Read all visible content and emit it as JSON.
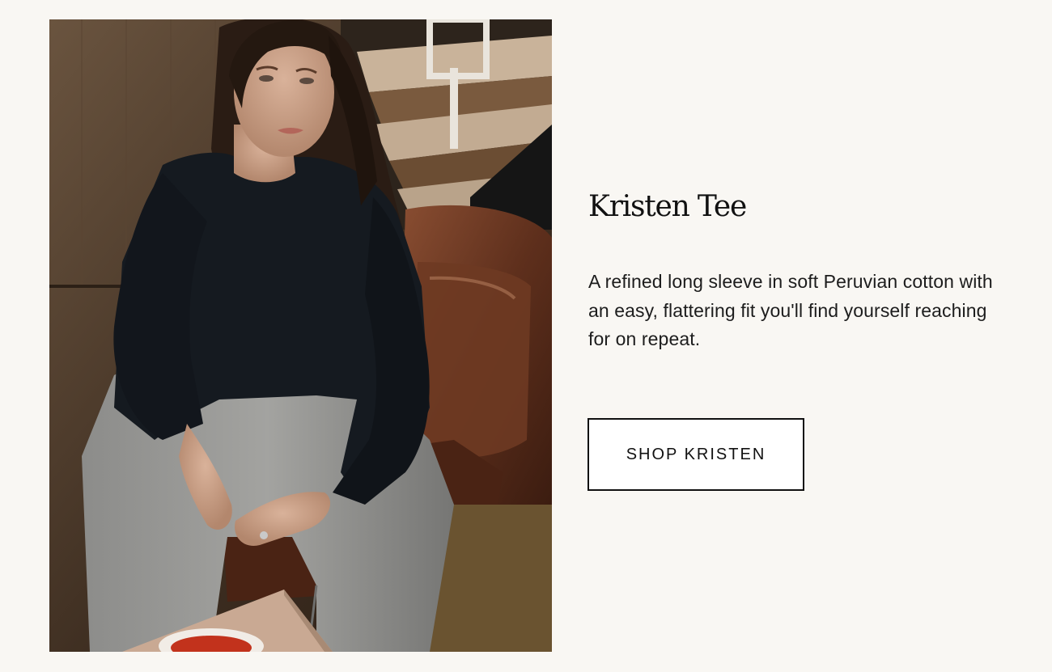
{
  "product": {
    "title": "Kristen Tee",
    "description": "A refined long sleeve in soft Peruvian cotton with an easy, flattering fit you'll find yourself reaching for on repeat.",
    "cta_label": "SHOP KRISTEN"
  },
  "colors": {
    "page_background": "#f9f7f3",
    "text": "#111111",
    "button_background": "#ffffff",
    "button_border": "#111111"
  }
}
